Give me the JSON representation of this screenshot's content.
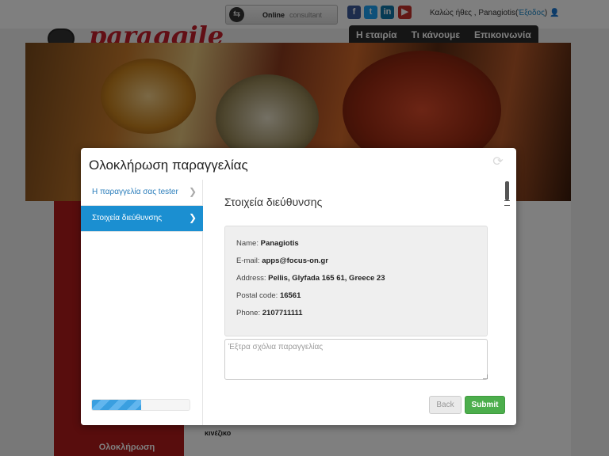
{
  "site": {
    "logo_text": "paraggile",
    "consult_online": "Online",
    "consult_label": "consultant",
    "social": [
      "facebook-icon",
      "twitter-icon",
      "linkedin-icon",
      "youtube-icon"
    ],
    "greeting": "Καλώς ήθες , Panagiotis(",
    "logout": "Έξοδος",
    "greeting_end": ")",
    "nav": [
      "Η εταιρία",
      "Τι κάνουμε",
      "Επικοινωνία"
    ],
    "ready_label": "Ολοκλήρωση",
    "cuisine_label": "κινέζικο"
  },
  "modal": {
    "title": "Ολοκλήρωση παραγγελίας",
    "steps": [
      {
        "label": "Η παραγγελία σας tester",
        "active": false
      },
      {
        "label": "Στοιχεία διεύθυνσης",
        "active": true
      }
    ],
    "progress_percent": 50,
    "section_title": "Στοιχεία διεύθυνσης",
    "address": {
      "name_label": "Name:",
      "name": "Panagiotis",
      "email_label": "E-mail:",
      "email": "apps@focus-on.gr",
      "address_label": "Address:",
      "address": "Pellis, Glyfada 165 61, Greece 23",
      "postal_label": "Postal code:",
      "postal": "16561",
      "phone_label": "Phone:",
      "phone": "2107711111"
    },
    "comments_placeholder": "Έξτρα σχόλια παραγγελίας",
    "back_label": "Back",
    "submit_label": "Submit"
  },
  "colors": {
    "accent": "#1b8fd1",
    "submit": "#4cae4c",
    "brand_red": "#c41e2a"
  }
}
